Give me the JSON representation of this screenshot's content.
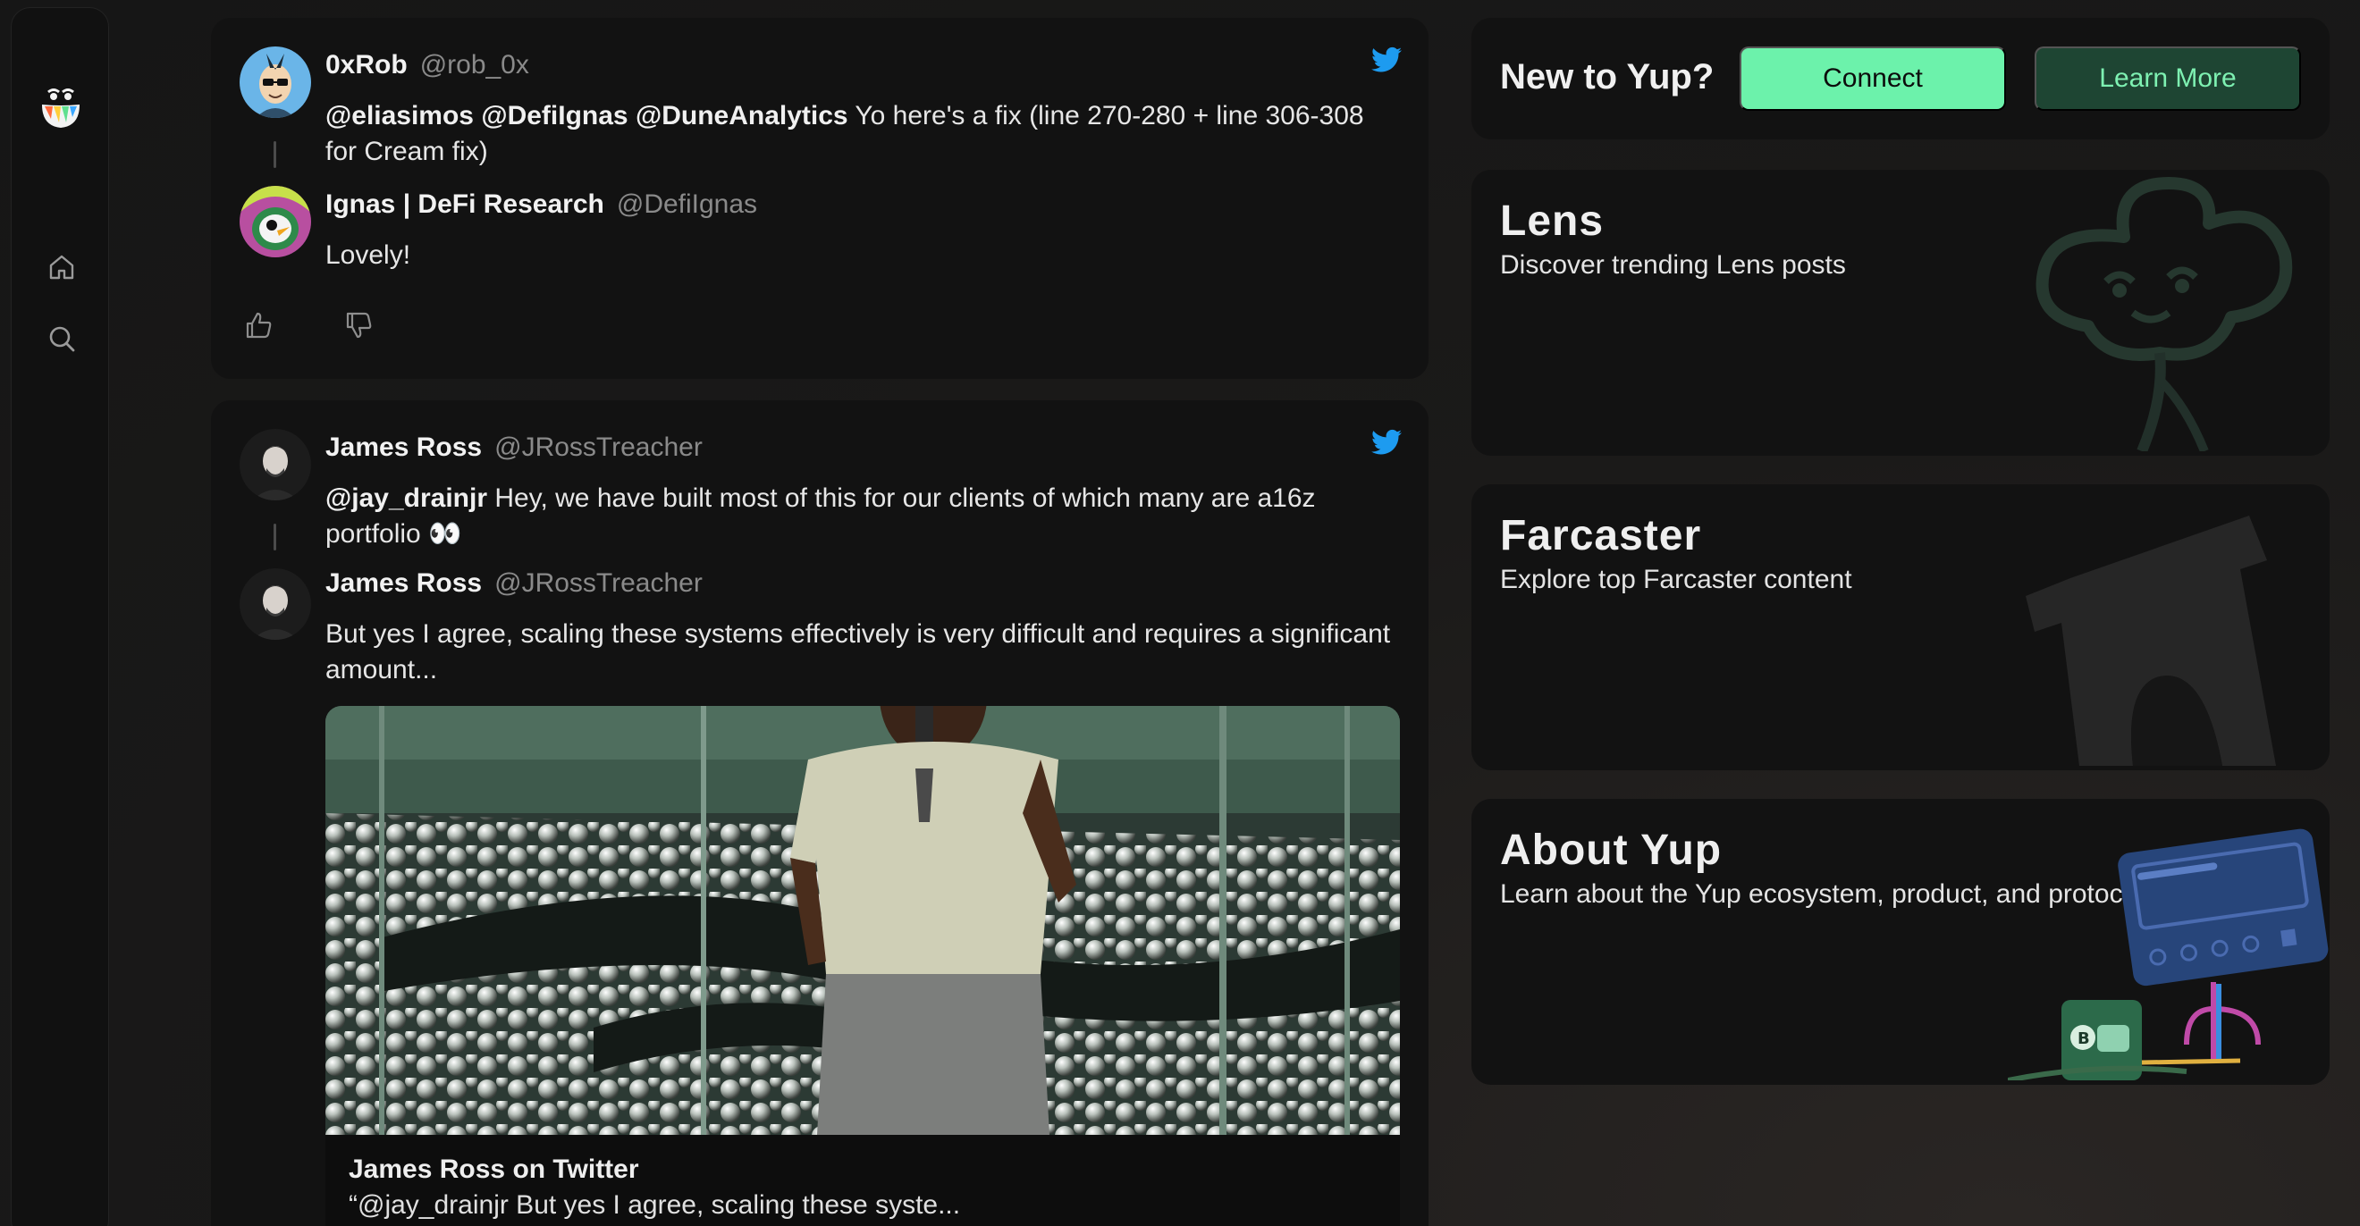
{
  "feed": {
    "posts": [
      {
        "source_icon": "twitter-icon",
        "primary": {
          "name": "0xRob",
          "handle": "@rob_0x",
          "mentions": "@eliasimos @DefiIgnas @DuneAnalytics",
          "text": " Yo here's a fix (line 270-280 + line 306-308 for Cream fix)"
        },
        "reply": {
          "name": "Ignas | DeFi Research",
          "handle": "@DefiIgnas",
          "text": "Lovely!"
        },
        "actions": {
          "upvote_icon": "thumbs-up-icon",
          "downvote_icon": "thumbs-down-icon"
        }
      },
      {
        "source_icon": "twitter-icon",
        "primary": {
          "name": "James Ross",
          "handle": "@JRossTreacher",
          "mentions": "@jay_drainjr",
          "text": " Hey, we have built most of this for our clients of which many are a16z portfolio 👀"
        },
        "reply": {
          "name": "James Ross",
          "handle": "@JRossTreacher",
          "text": "But yes I agree, scaling these systems effectively is very difficult and requires a significant amount..."
        },
        "media": {
          "caption_title": "James Ross on Twitter",
          "caption_quote": "“@jay_drainjr But yes I agree, scaling these syste..."
        }
      }
    ]
  },
  "sidebar": {
    "logo": "yup-logo-icon",
    "items": [
      {
        "icon": "home-icon"
      },
      {
        "icon": "search-icon"
      }
    ]
  },
  "signup": {
    "title": "New to Yup?",
    "connect_label": "Connect",
    "learn_more_label": "Learn More"
  },
  "features": [
    {
      "title": "Lens",
      "subtitle": "Discover trending Lens posts",
      "art": "lens-clover-icon"
    },
    {
      "title": "Farcaster",
      "subtitle": "Explore top Farcaster content",
      "art": "farcaster-arch-icon"
    },
    {
      "title": "About Yup",
      "subtitle": "Learn about the Yup ecosystem, product, and protocol.",
      "art": "yup-app-illustration"
    }
  ],
  "colors": {
    "accent": "#6cf2ab",
    "accent_dark": "#1e4533",
    "twitter": "#1d9bf0",
    "card": "#121212"
  }
}
